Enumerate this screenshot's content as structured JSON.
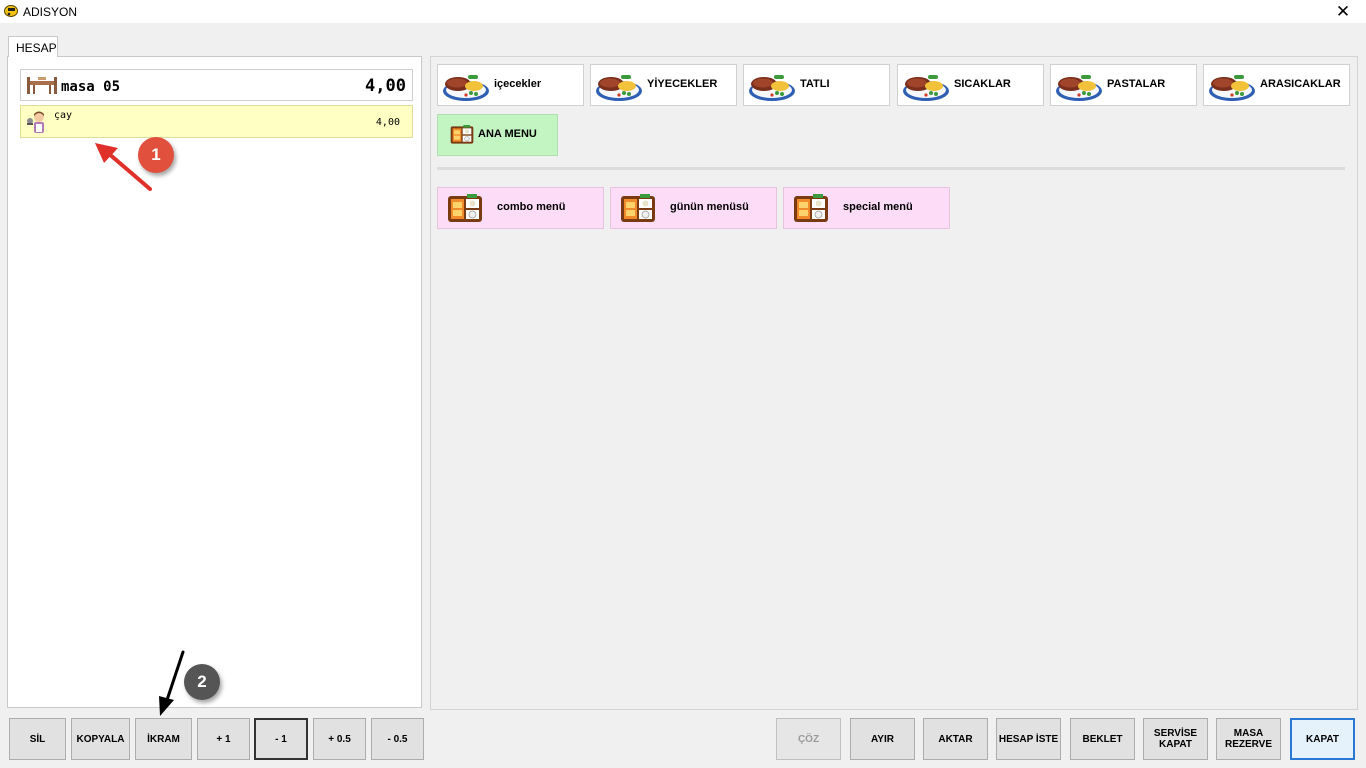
{
  "window": {
    "title": "ADISYON",
    "close_glyph": "✕"
  },
  "tab": {
    "label": "HESAP"
  },
  "table": {
    "name": "masa 05",
    "total": "4,00"
  },
  "order_items": [
    {
      "name": "çay",
      "price": "4,00"
    }
  ],
  "categories": [
    {
      "label": "içecekler"
    },
    {
      "label": "YİYECEKLER"
    },
    {
      "label": "TATLI"
    },
    {
      "label": "SICAKLAR"
    },
    {
      "label": "PASTALAR"
    },
    {
      "label": "ARASICAKLAR"
    }
  ],
  "home_button": {
    "label": "ANA MENU"
  },
  "menus": [
    {
      "label": "combo menü"
    },
    {
      "label": "günün menüsü"
    },
    {
      "label": "special menü"
    }
  ],
  "bottom_left": [
    {
      "label": "SİL"
    },
    {
      "label": "KOPYALA"
    },
    {
      "label": "İKRAM"
    },
    {
      "label": "+ 1"
    },
    {
      "label": "- 1"
    },
    {
      "label": "+ 0.5"
    },
    {
      "label": "- 0.5"
    }
  ],
  "bottom_right": [
    {
      "label": "ÇÖZ"
    },
    {
      "label": "AYIR"
    },
    {
      "label": "AKTAR"
    },
    {
      "label": "HESAP İSTE"
    },
    {
      "label": "BEKLET"
    },
    {
      "label": "SERVİSE KAPAT"
    },
    {
      "label": "MASA REZERVE"
    },
    {
      "label": "KAPAT"
    }
  ],
  "annotations": [
    {
      "number": "1",
      "color": "#e0503c"
    },
    {
      "number": "2",
      "color": "#555555"
    }
  ]
}
